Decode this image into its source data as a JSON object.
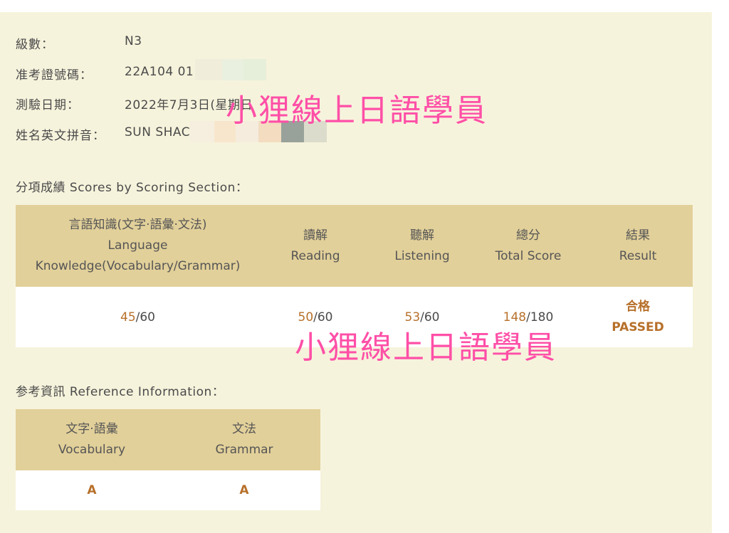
{
  "info": {
    "level_label": "級數：",
    "level_value": "N3",
    "exam_no_label": "准考證號碼：",
    "exam_no_value": "22A104 01",
    "test_date_label": "測驗日期：",
    "test_date_value": "2022年7月3日(星期日",
    "name_label": "姓名英文拼音：",
    "name_value": "SUN SHAC"
  },
  "scores_section": {
    "title": "分項成績 Scores by Scoring Section：",
    "headers": [
      {
        "zh": "言語知識(文字·語彙·文法)",
        "en1": "Language",
        "en2": "Knowledge(Vocabulary/Grammar)"
      },
      {
        "zh": "讀解",
        "en1": "Reading"
      },
      {
        "zh": "聽解",
        "en1": "Listening"
      },
      {
        "zh": "總分",
        "en1": "Total Score"
      },
      {
        "zh": "結果",
        "en1": "Result"
      }
    ],
    "values": {
      "knowledge_score": "45",
      "knowledge_max": "/60",
      "reading_score": "50",
      "reading_max": "/60",
      "listening_score": "53",
      "listening_max": "/60",
      "total_score": "148",
      "total_max": "/180",
      "result_zh": "合格",
      "result_en": "PASSED"
    }
  },
  "reference_section": {
    "title": "参考資訊 Reference Information：",
    "headers": [
      {
        "zh": "文字·語彙",
        "en1": "Vocabulary"
      },
      {
        "zh": "文法",
        "en1": "Grammar"
      }
    ],
    "values": {
      "vocabulary": "A",
      "grammar": "A"
    }
  },
  "watermark_text": "小狸線上日語學員",
  "colors": {
    "panel": "#f6f3dc",
    "header": "#e2d09a",
    "score": "#b7702a",
    "watermark": "#ff4fa7"
  }
}
